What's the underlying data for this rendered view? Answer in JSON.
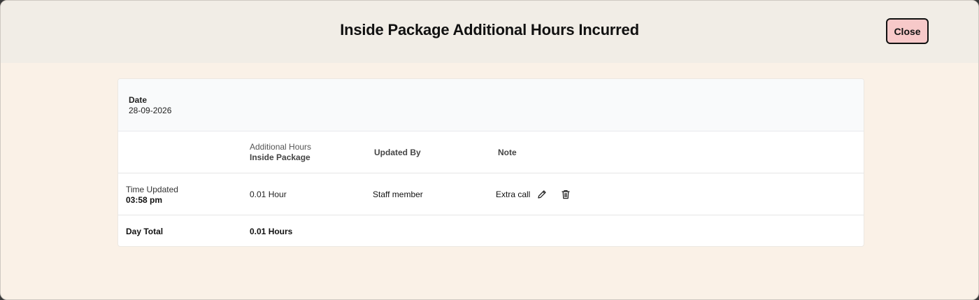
{
  "modal": {
    "title": "Inside Package Additional Hours Incurred",
    "close_label": "Close"
  },
  "date_section": {
    "label": "Date",
    "value": "28-09-2026"
  },
  "table": {
    "headers": {
      "hours_line1": "Additional Hours",
      "hours_line2": "Inside Package",
      "updated_by": "Updated By",
      "note": "Note"
    },
    "rows": [
      {
        "time_label": "Time Updated",
        "time_value": "03:58 pm",
        "hours": "0.01 Hour",
        "updated_by": "Staff member",
        "note": "Extra call"
      }
    ],
    "total": {
      "label": "Day Total",
      "value": "0.01 Hours"
    }
  },
  "icons": {
    "edit": "pencil-icon",
    "delete": "trash-icon"
  },
  "colors": {
    "header_bg": "#f1ede6",
    "body_bg": "#faf1e7",
    "close_button_bg": "#f7c9c9"
  }
}
